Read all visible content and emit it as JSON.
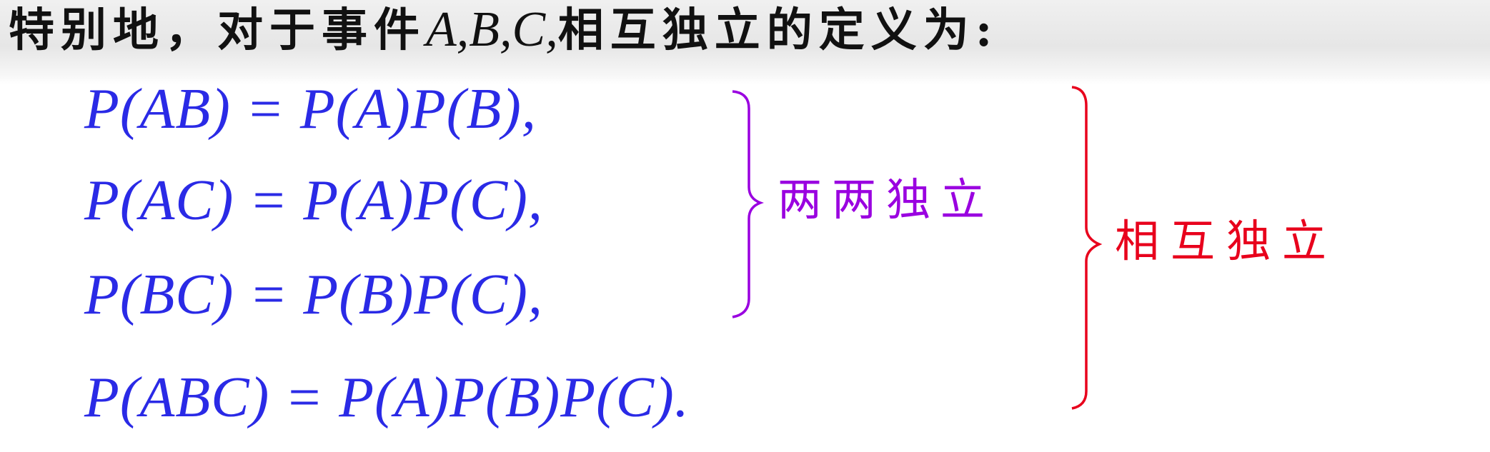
{
  "heading": {
    "text": "特别地，对于事件",
    "events": "A,B,C,",
    "rest": "相互独立的定义为",
    "colon": ":"
  },
  "equations": [
    "P(AB) = P(A)P(B),",
    "P(AC) = P(A)P(C),",
    "P(BC) = P(B)P(C),",
    "P(ABC) = P(A)P(B)P(C)."
  ],
  "labels": {
    "pairwise": "两两独立",
    "mutual": "相互独立"
  },
  "colors": {
    "equation": "#2a2ae6",
    "pairwise": "#9a00e0",
    "mutual": "#e8001c",
    "heading": "#111111"
  }
}
